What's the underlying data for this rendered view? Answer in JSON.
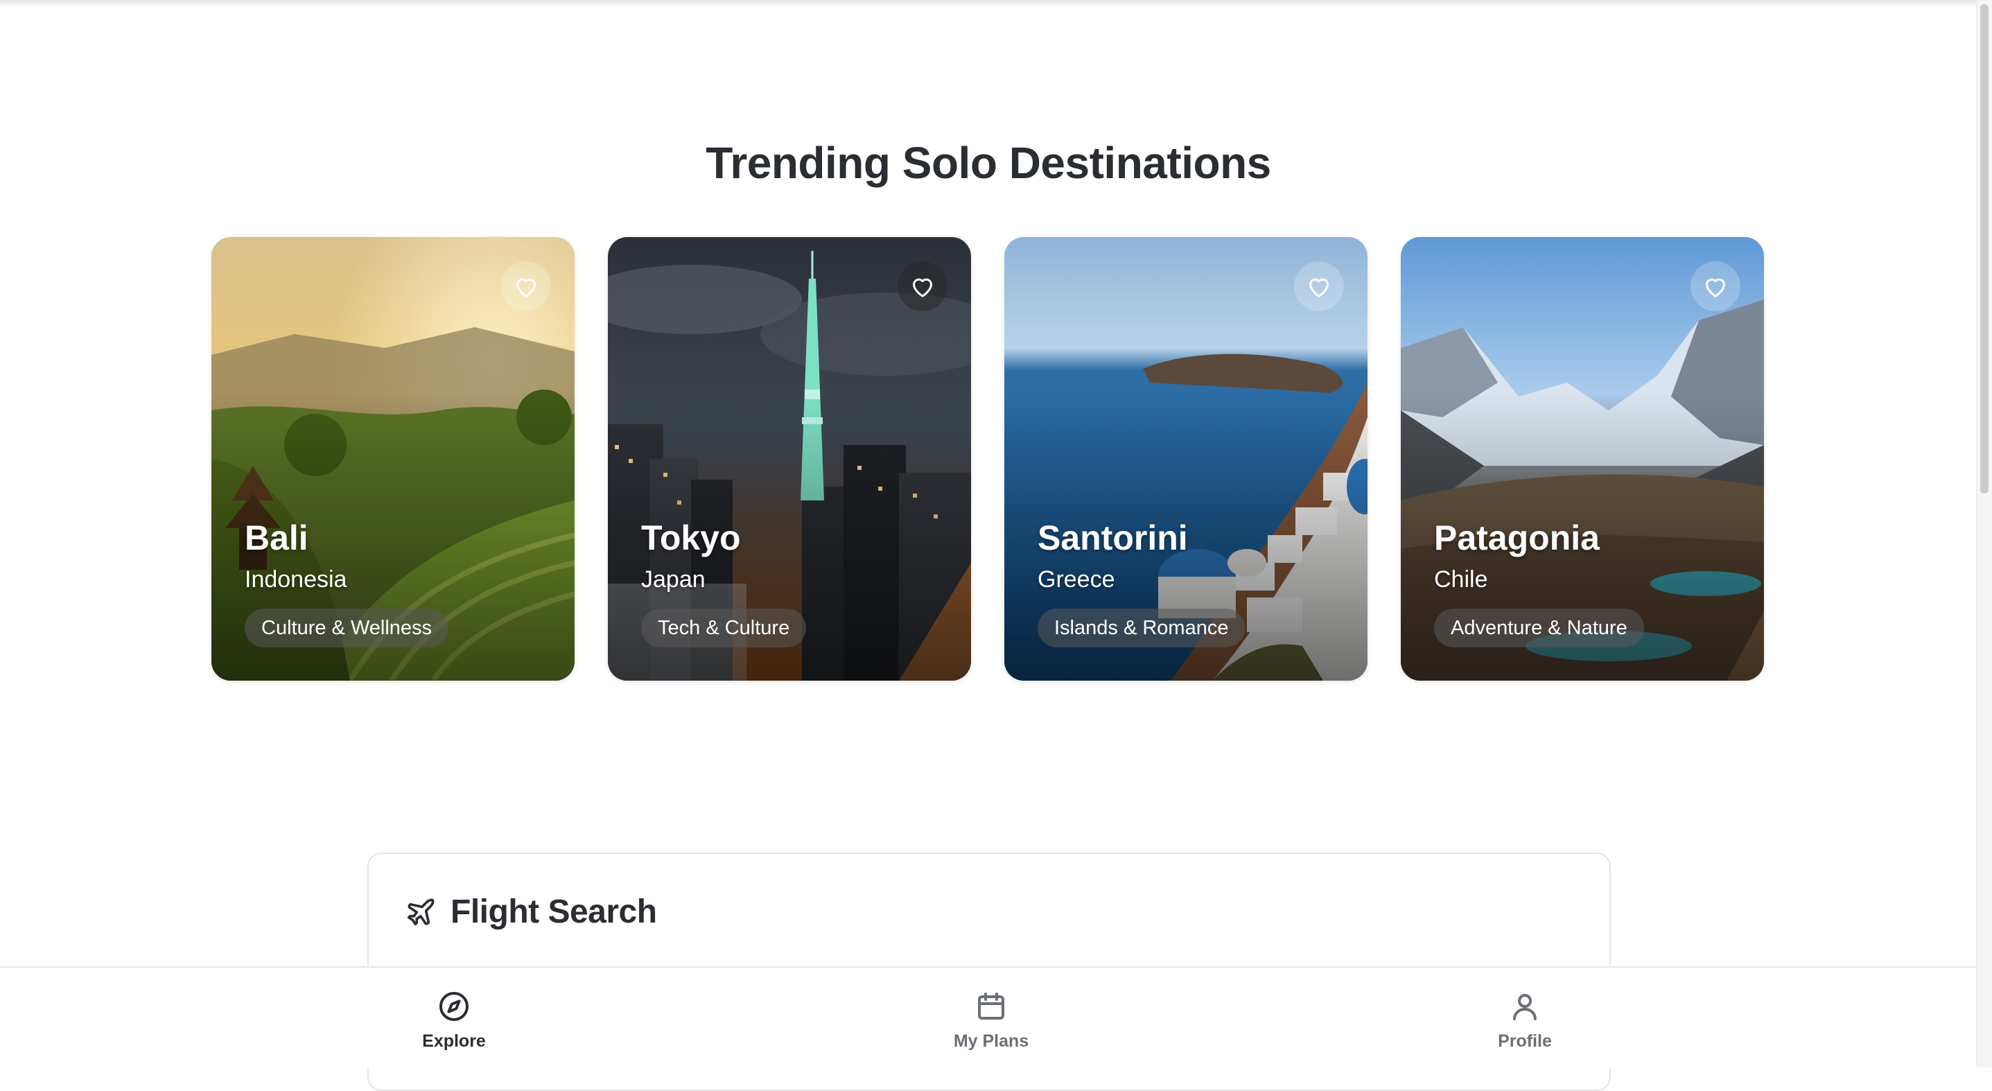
{
  "section": {
    "title": "Trending Solo Destinations"
  },
  "destinations": [
    {
      "city": "Bali",
      "country": "Indonesia",
      "tag": "Culture & Wellness"
    },
    {
      "city": "Tokyo",
      "country": "Japan",
      "tag": "Tech & Culture"
    },
    {
      "city": "Santorini",
      "country": "Greece",
      "tag": "Islands & Romance"
    },
    {
      "city": "Patagonia",
      "country": "Chile",
      "tag": "Adventure & Nature"
    }
  ],
  "flight_search": {
    "title": "Flight Search",
    "icon": "plane-icon"
  },
  "bottom_nav": {
    "items": [
      {
        "label": "Explore",
        "icon": "compass-icon",
        "active": true
      },
      {
        "label": "My Plans",
        "icon": "calendar-icon",
        "active": false
      },
      {
        "label": "Profile",
        "icon": "user-icon",
        "active": false
      }
    ]
  },
  "colors": {
    "text_primary": "#2a2d31",
    "text_muted": "#6b6f75",
    "border": "#e4e4e4"
  }
}
